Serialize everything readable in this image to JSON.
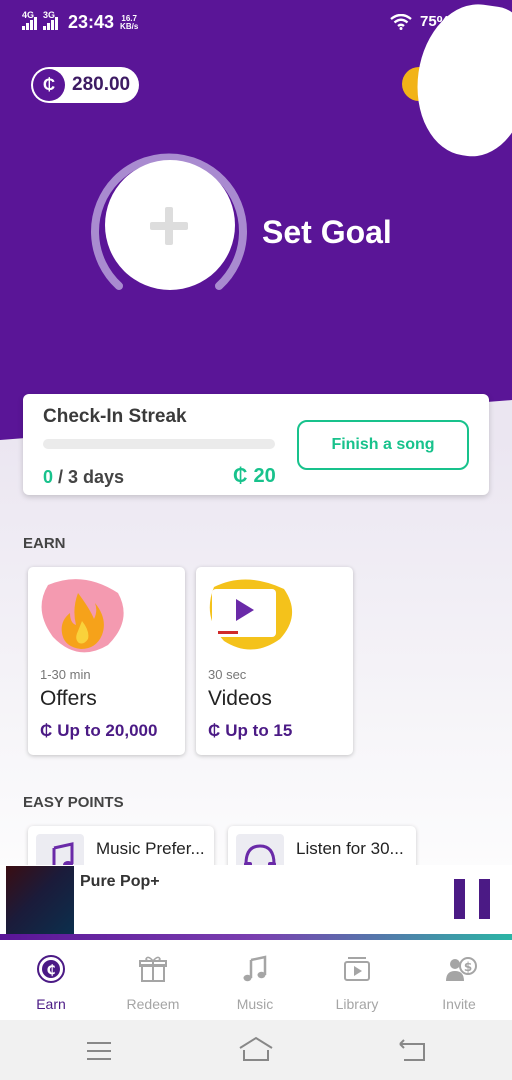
{
  "status_bar": {
    "network_1": "4G",
    "network_2": "3G",
    "time": "23:43",
    "speed_value": "16.7",
    "speed_unit": "KB/s",
    "battery": "75%"
  },
  "header": {
    "coin_symbol": "₵",
    "balance": "280.00",
    "goal_label": "Set Goal"
  },
  "checkin": {
    "title": "Check-In Streak",
    "days_current": "0",
    "days_total": " / 3 days",
    "reward": "20",
    "progress": 0,
    "action_label": "Finish a song"
  },
  "earn": {
    "section_title": "EARN",
    "tiles": [
      {
        "meta": "1-30 min",
        "name": "Offers",
        "amount": "Up to 20,000",
        "icon": "fire-icon"
      },
      {
        "meta": "30 sec",
        "name": "Videos",
        "amount": "Up to 15",
        "icon": "video-player-icon"
      }
    ]
  },
  "easy_points": {
    "section_title": "EASY POINTS",
    "items": [
      {
        "label": "Music Prefer...",
        "icon": "music-note-icon"
      },
      {
        "label": "Listen for 30...",
        "icon": "headphones-icon"
      }
    ]
  },
  "player": {
    "song": "Pure Pop+",
    "progress": 1.0
  },
  "nav": {
    "items": [
      {
        "label": "Earn",
        "icon": "earn-coin-icon",
        "active": true
      },
      {
        "label": "Redeem",
        "icon": "gift-icon",
        "active": false
      },
      {
        "label": "Music",
        "icon": "music-note-icon",
        "active": false
      },
      {
        "label": "Library",
        "icon": "library-icon",
        "active": false
      },
      {
        "label": "Invite",
        "icon": "invite-icon",
        "active": false
      }
    ]
  },
  "colors": {
    "brand_purple": "#5a1597",
    "accent_green": "#18c28c",
    "deep_purple": "#4b1a85",
    "gold": "#f2b318"
  }
}
